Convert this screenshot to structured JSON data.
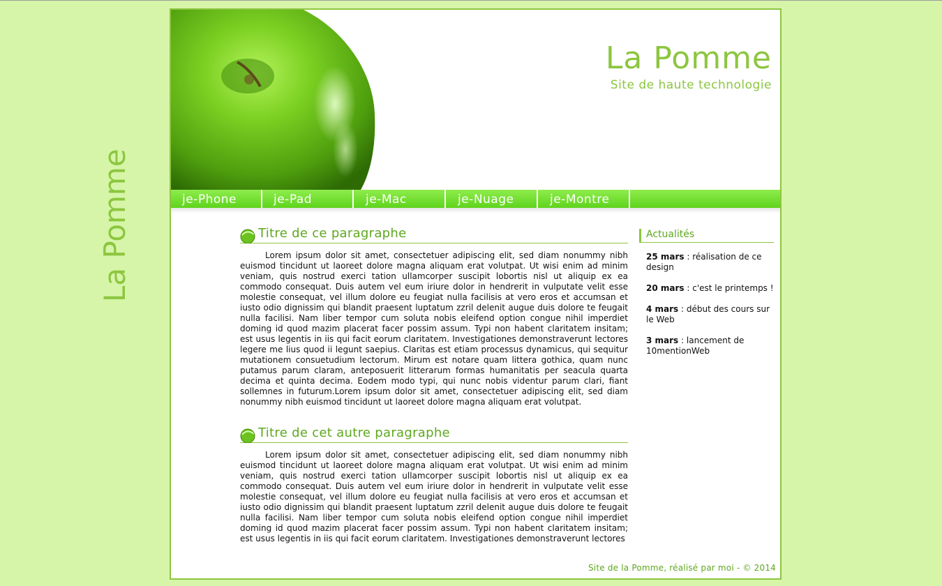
{
  "header": {
    "title": "La Pomme",
    "subtitle": "Site de haute technologie"
  },
  "nav": {
    "items": [
      "je-Phone",
      "je-Pad",
      "je-Mac",
      "je-Nuage",
      "je-Montre"
    ]
  },
  "vertical_title": "La Pomme",
  "main": {
    "sections": [
      {
        "title": "Titre de ce paragraphe",
        "text": "Lorem ipsum dolor sit amet, consectetuer adipiscing elit, sed diam nonummy nibh euismod tincidunt ut laoreet dolore magna aliquam erat volutpat. Ut wisi enim ad minim veniam, quis nostrud exerci tation ullamcorper suscipit lobortis nisl ut aliquip ex ea commodo consequat. Duis autem vel eum iriure dolor in hendrerit in vulputate velit esse molestie consequat, vel illum dolore eu feugiat nulla facilisis at vero eros et accumsan et iusto odio dignissim qui blandit praesent luptatum zzril delenit augue duis dolore te feugait nulla facilisi. Nam liber tempor cum soluta nobis eleifend option congue nihil imperdiet doming id quod mazim placerat facer possim assum. Typi non habent claritatem insitam; est usus legentis in iis qui facit eorum claritatem. Investigationes demonstraverunt lectores legere me lius quod ii legunt saepius. Claritas est etiam processus dynamicus, qui sequitur mutationem consuetudium lectorum. Mirum est notare quam littera gothica, quam nunc putamus parum claram, anteposuerit litterarum formas humanitatis per seacula quarta decima et quinta decima. Eodem modo typi, qui nunc nobis videntur parum clari, fiant sollemnes in futurum.Lorem ipsum dolor sit amet, consectetuer adipiscing elit, sed diam nonummy nibh euismod tincidunt ut laoreet dolore magna aliquam erat volutpat."
      },
      {
        "title": "Titre de cet autre paragraphe",
        "text": "Lorem ipsum dolor sit amet, consectetuer adipiscing elit, sed diam nonummy nibh euismod tincidunt ut laoreet dolore magna aliquam erat volutpat. Ut wisi enim ad minim veniam, quis nostrud exerci tation ullamcorper suscipit lobortis nisl ut aliquip ex ea commodo consequat. Duis autem vel eum iriure dolor in hendrerit in vulputate velit esse molestie consequat, vel illum dolore eu feugiat nulla facilisis at vero eros et accumsan et iusto odio dignissim qui blandit praesent luptatum zzril delenit augue duis dolore te feugait nulla facilisi. Nam liber tempor cum soluta nobis eleifend option congue nihil imperdiet doming id quod mazim placerat facer possim assum. Typi non habent claritatem insitam; est usus legentis in iis qui facit eorum claritatem. Investigationes demonstraverunt lectores"
      }
    ]
  },
  "sidebar": {
    "title": "Actualités",
    "news": [
      {
        "date": "25 mars",
        "text": " : réalisation de ce design"
      },
      {
        "date": "20 mars",
        "text": " : c'est le printemps !"
      },
      {
        "date": "4 mars",
        "text": " : début des cours sur le Web"
      },
      {
        "date": "3 mars",
        "text": " : lancement de 10mentionWeb"
      }
    ]
  },
  "footer": "Site de la Pomme, réalisé par moi - © 2014",
  "colors": {
    "background": "#d6f5a8",
    "accent": "#8cc63f",
    "nav": "#6bdc2c",
    "heading": "#5ea81e"
  },
  "icons": {
    "header_image": "green-apple",
    "heading_bullet": "apple-bullet-icon"
  }
}
